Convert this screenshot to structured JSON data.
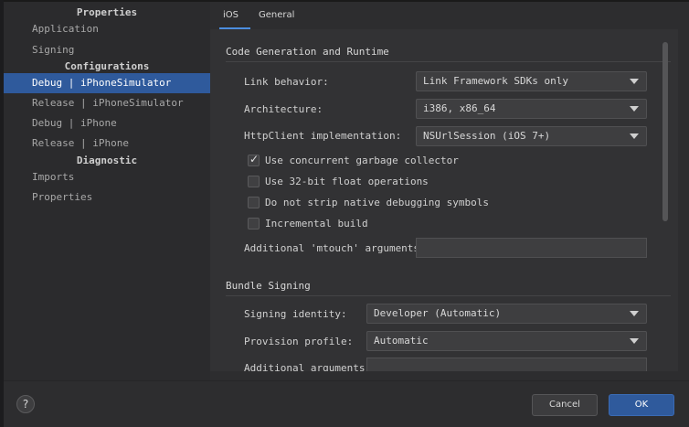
{
  "sidebar": {
    "sections": [
      {
        "header": "Properties",
        "items": [
          "Application",
          "Signing"
        ]
      },
      {
        "header": "Configurations",
        "items": [
          "Debug | iPhoneSimulator",
          "Release | iPhoneSimulator",
          "Debug | iPhone",
          "Release | iPhone"
        ]
      },
      {
        "header": "Diagnostic",
        "items": [
          "Imports",
          "Properties"
        ]
      }
    ],
    "selected": "Debug | iPhoneSimulator"
  },
  "tabs": [
    {
      "label": "iOS",
      "active": true
    },
    {
      "label": "General",
      "active": false
    }
  ],
  "codegen": {
    "title": "Code Generation and Runtime",
    "link_behavior_label": "Link behavior:",
    "link_behavior_value": "Link Framework SDKs only",
    "architecture_label": "Architecture:",
    "architecture_value": "i386, x86_64",
    "httpclient_label": "HttpClient implementation:",
    "httpclient_value": "NSUrlSession (iOS 7+)",
    "checkboxes": [
      {
        "label": "Use concurrent garbage collector",
        "checked": true
      },
      {
        "label": "Use 32-bit float operations",
        "checked": false
      },
      {
        "label": "Do not strip native debugging symbols",
        "checked": false
      },
      {
        "label": "Incremental build",
        "checked": false
      }
    ],
    "mtouch_label": "Additional 'mtouch' arguments:",
    "mtouch_value": ""
  },
  "bundle": {
    "title": "Bundle Signing",
    "identity_label": "Signing identity:",
    "identity_value": "Developer (Automatic)",
    "profile_label": "Provision profile:",
    "profile_value": "Automatic",
    "args_label": "Additional arguments:",
    "args_value": ""
  },
  "footer": {
    "help": "?",
    "cancel": "Cancel",
    "ok": "OK"
  },
  "colors": {
    "accent": "#2f5a9c",
    "tab_underline": "#4c8ee0",
    "background": "#2d2d2f"
  }
}
